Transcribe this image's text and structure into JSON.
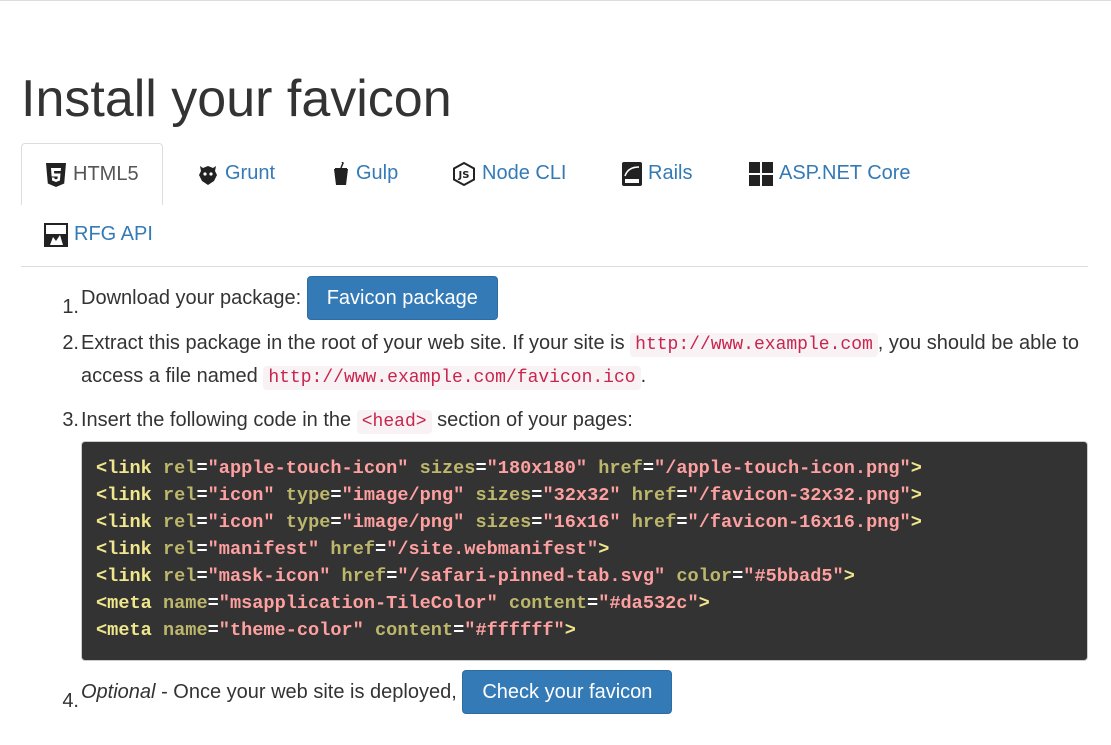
{
  "page_title": "Install your favicon",
  "tabs": [
    {
      "label": "HTML5",
      "icon": "html5-icon",
      "active": true
    },
    {
      "label": "Grunt",
      "icon": "grunt-icon",
      "active": false
    },
    {
      "label": "Gulp",
      "icon": "gulp-icon",
      "active": false
    },
    {
      "label": "Node CLI",
      "icon": "nodejs-icon",
      "active": false
    },
    {
      "label": "Rails",
      "icon": "rails-icon",
      "active": false
    },
    {
      "label": "ASP.NET Core",
      "icon": "windows-icon",
      "active": false
    },
    {
      "label": "RFG API",
      "icon": "rfg-api-icon",
      "active": false
    }
  ],
  "steps": {
    "s1": {
      "num": "1.",
      "text": "Download your package:",
      "button": "Favicon package"
    },
    "s2": {
      "num": "2.",
      "text_a": "Extract this package in the root of your web site. If your site is",
      "code_a": "http://www.example.com",
      "text_b": ", you should be able to access a file named",
      "code_b": "http://www.example.com/favicon.ico",
      "text_c": "."
    },
    "s3": {
      "num": "3.",
      "text_a": "Insert the following code in the",
      "code": "<head>",
      "text_b": "section of your pages:"
    },
    "s4": {
      "num": "4.",
      "optional": "Optional",
      "text": "- Once your web site is deployed,",
      "button": "Check your favicon"
    }
  },
  "code_lines": [
    [
      [
        "tag",
        "<link"
      ],
      [
        "attr",
        "rel"
      ],
      [
        "eq",
        "="
      ],
      [
        "val",
        "\"apple-touch-icon\""
      ],
      [
        "attr",
        "sizes"
      ],
      [
        "eq",
        "="
      ],
      [
        "val",
        "\"180x180\""
      ],
      [
        "attr",
        "href"
      ],
      [
        "eq",
        "="
      ],
      [
        "val",
        "\"/apple-touch-icon.png\""
      ],
      [
        "tag",
        ">"
      ]
    ],
    [
      [
        "tag",
        "<link"
      ],
      [
        "attr",
        "rel"
      ],
      [
        "eq",
        "="
      ],
      [
        "val",
        "\"icon\""
      ],
      [
        "attr",
        "type"
      ],
      [
        "eq",
        "="
      ],
      [
        "val",
        "\"image/png\""
      ],
      [
        "attr",
        "sizes"
      ],
      [
        "eq",
        "="
      ],
      [
        "val",
        "\"32x32\""
      ],
      [
        "attr",
        "href"
      ],
      [
        "eq",
        "="
      ],
      [
        "val",
        "\"/favicon-32x32.png\""
      ],
      [
        "tag",
        ">"
      ]
    ],
    [
      [
        "tag",
        "<link"
      ],
      [
        "attr",
        "rel"
      ],
      [
        "eq",
        "="
      ],
      [
        "val",
        "\"icon\""
      ],
      [
        "attr",
        "type"
      ],
      [
        "eq",
        "="
      ],
      [
        "val",
        "\"image/png\""
      ],
      [
        "attr",
        "sizes"
      ],
      [
        "eq",
        "="
      ],
      [
        "val",
        "\"16x16\""
      ],
      [
        "attr",
        "href"
      ],
      [
        "eq",
        "="
      ],
      [
        "val",
        "\"/favicon-16x16.png\""
      ],
      [
        "tag",
        ">"
      ]
    ],
    [
      [
        "tag",
        "<link"
      ],
      [
        "attr",
        "rel"
      ],
      [
        "eq",
        "="
      ],
      [
        "val",
        "\"manifest\""
      ],
      [
        "attr",
        "href"
      ],
      [
        "eq",
        "="
      ],
      [
        "val",
        "\"/site.webmanifest\""
      ],
      [
        "tag",
        ">"
      ]
    ],
    [
      [
        "tag",
        "<link"
      ],
      [
        "attr",
        "rel"
      ],
      [
        "eq",
        "="
      ],
      [
        "val",
        "\"mask-icon\""
      ],
      [
        "attr",
        "href"
      ],
      [
        "eq",
        "="
      ],
      [
        "val",
        "\"/safari-pinned-tab.svg\""
      ],
      [
        "attr",
        "color"
      ],
      [
        "eq",
        "="
      ],
      [
        "val",
        "\"#5bbad5\""
      ],
      [
        "tag",
        ">"
      ]
    ],
    [
      [
        "tag",
        "<meta"
      ],
      [
        "attr",
        "name"
      ],
      [
        "eq",
        "="
      ],
      [
        "val",
        "\"msapplication-TileColor\""
      ],
      [
        "attr",
        "content"
      ],
      [
        "eq",
        "="
      ],
      [
        "val",
        "\"#da532c\""
      ],
      [
        "tag",
        ">"
      ]
    ],
    [
      [
        "tag",
        "<meta"
      ],
      [
        "attr",
        "name"
      ],
      [
        "eq",
        "="
      ],
      [
        "val",
        "\"theme-color\""
      ],
      [
        "attr",
        "content"
      ],
      [
        "eq",
        "="
      ],
      [
        "val",
        "\"#ffffff\""
      ],
      [
        "tag",
        ">"
      ]
    ]
  ],
  "colors": {
    "link": "#337ab7",
    "button": "#337ab7",
    "code_bg": "#333333",
    "inline_code": "#c7254e"
  }
}
